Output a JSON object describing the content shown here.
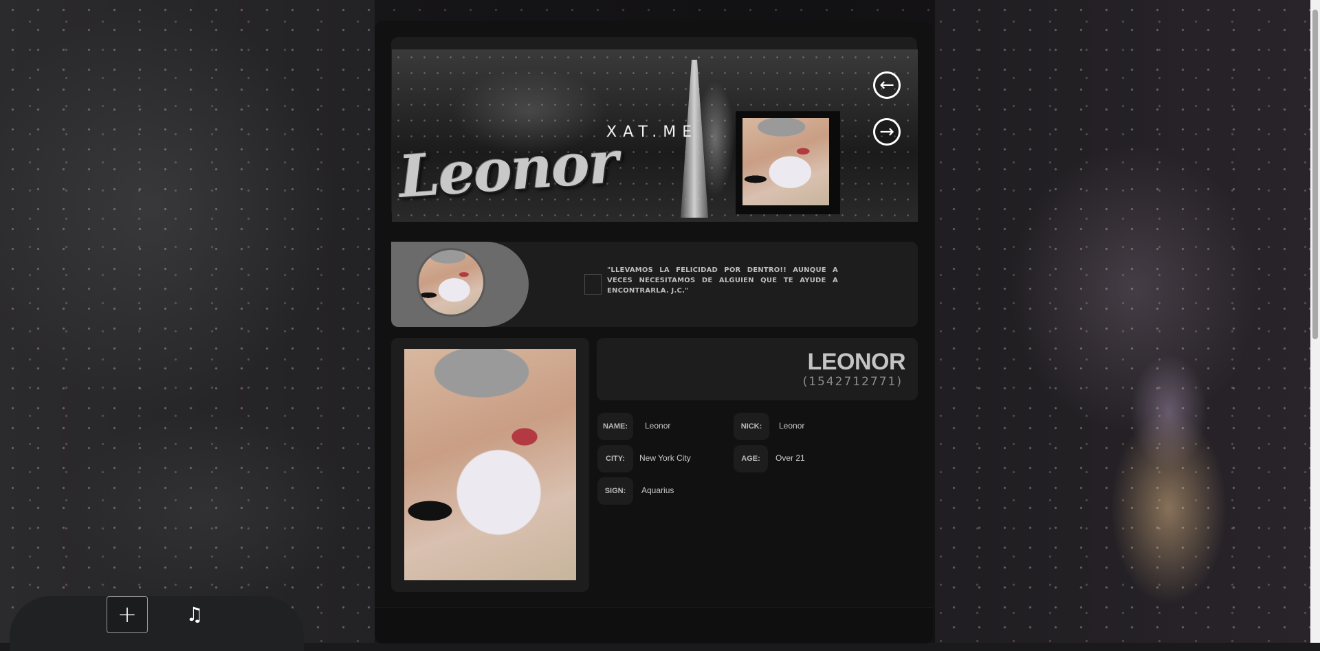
{
  "banner": {
    "brand": "XAT.ME",
    "name": "Leonor"
  },
  "nav": {
    "prev_icon": "arrow-left-icon",
    "next_icon": "arrow-right-icon"
  },
  "quote": {
    "text": "\"LLEVAMOS LA FELICIDAD POR DENTRO!! AUNQUE A VECES NECESITAMOS DE ALGUIEN QUE TE AYUDE A ENCONTRARLA. J.C.\""
  },
  "profile": {
    "display_name": "LEONOR",
    "user_id": "(1542712771)",
    "fields": {
      "name_label": "NAME:",
      "name_value": "Leonor",
      "nick_label": "NICK:",
      "nick_value": "Leonor",
      "city_label": "CITY:",
      "city_value": "New York City",
      "age_label": "AGE:",
      "age_value": "Over 21",
      "sign_label": "SIGN:",
      "sign_value": "Aquarius"
    }
  },
  "toolbar": {
    "add_label": "+",
    "music_label": "♫"
  }
}
